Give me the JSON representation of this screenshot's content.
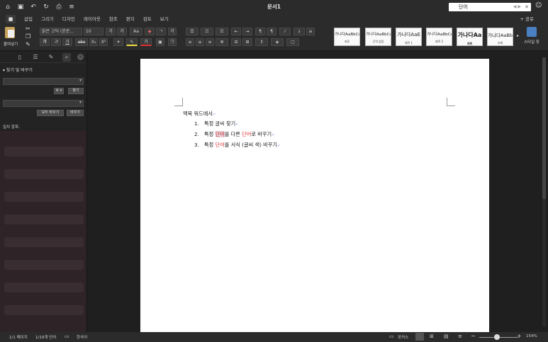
{
  "titlebar": {
    "title": "문서1",
    "search_value": "단어",
    "search_arrows": "◀  ▶",
    "search_clear": "✕",
    "icons": [
      "home-icon",
      "save-icon",
      "undo-icon",
      "redo-icon",
      "print-icon",
      "customize-icon"
    ]
  },
  "menu": {
    "tabs": [
      "삽입",
      "그리기",
      "디자인",
      "레이아웃",
      "참조",
      "편지",
      "검토",
      "보기"
    ],
    "share": "+ 공유"
  },
  "ribbon": {
    "paste_label": "붙여넣기",
    "font_name": "맑은 고딕 (본문...",
    "font_size": "10",
    "grow": "가",
    "shrink": "가",
    "bold": "가",
    "italic": "가",
    "underline": "가",
    "strike": "abc",
    "sub": "X₂",
    "sup": "X²",
    "aa": "Aa",
    "styles": [
      {
        "sample": "가나다AaBbCc",
        "name": "표준"
      },
      {
        "sample": "가나다AaBbCc",
        "name": "간격 없음"
      },
      {
        "sample": "가나다AaE",
        "name": "제목 1"
      },
      {
        "sample": "가나다AaBbCc",
        "name": "제목 2"
      },
      {
        "sample": "가나다Aa",
        "name": "제목"
      },
      {
        "sample": "가나다AaBb",
        "name": "부제"
      }
    ],
    "styles_pane": "스타일 창"
  },
  "leftpane": {
    "header": "▾ 찾기 및 바꾸기",
    "find_btn": "찾기",
    "gear": "⚙ ▾",
    "replace_all_btn": "모두 바꾸기",
    "replace_btn": "바꾸기",
    "results_label": "일치 항목:"
  },
  "document": {
    "line0": "맥북 워드에서",
    "items": [
      {
        "num": "1.",
        "pre": "특정 글씨 찾기",
        "w1": "",
        "mid": "",
        "w2": "",
        "post": ""
      },
      {
        "num": "2.",
        "pre": "특정 ",
        "w1": "단어",
        "mid": "를 다른 ",
        "w2": "단어",
        "post": "로 바꾸기"
      },
      {
        "num": "3.",
        "pre": "특정 ",
        "w1": "단어",
        "mid": "를 서식 (글씨 색) 바꾸기",
        "w2": "",
        "post": ""
      }
    ],
    "pilcrow": "↵"
  },
  "statusbar": {
    "page": "1/1 페이지",
    "words": "1/19개 단어",
    "lang": "한국어",
    "focus": "포커스",
    "zoom": "154%",
    "minus": "−",
    "plus": "+"
  }
}
